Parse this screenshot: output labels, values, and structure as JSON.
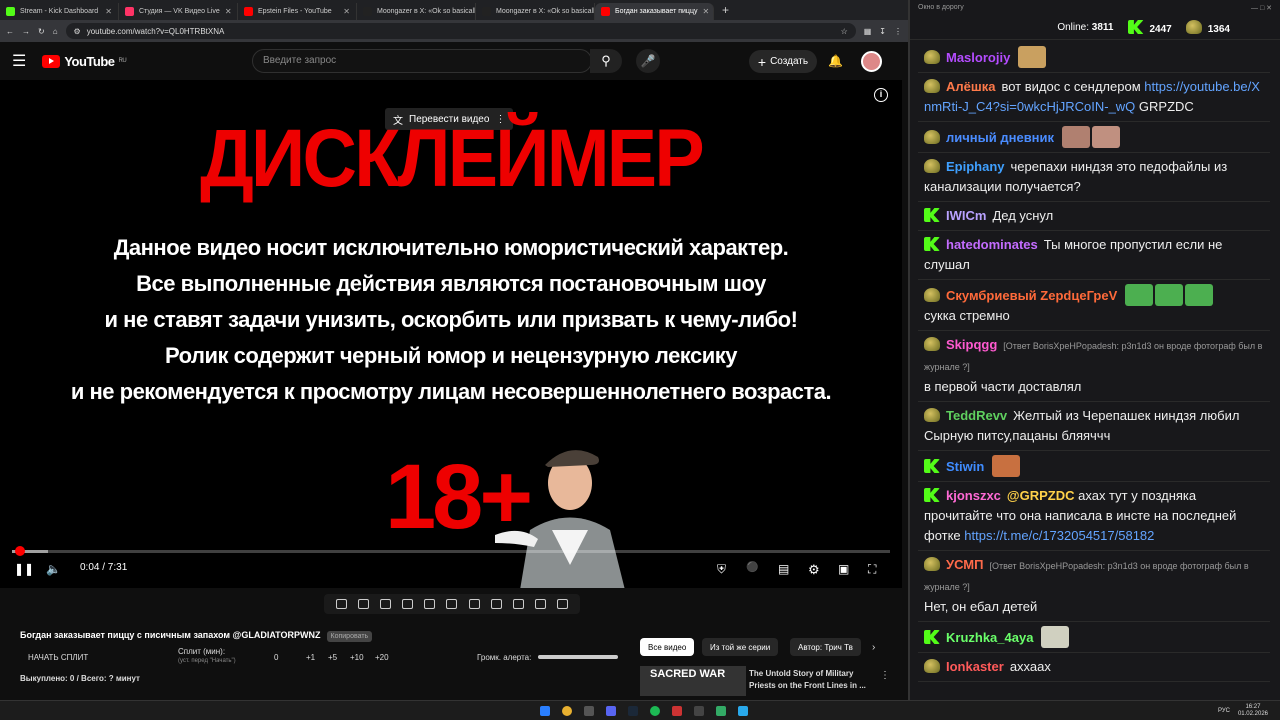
{
  "browser": {
    "tabs": [
      {
        "label": "Stream - Kick Dashboard",
        "color": "#53fc18"
      },
      {
        "label": "Студия — VK Видео Live",
        "color": "#ff3366"
      },
      {
        "label": "Epstein Files - YouTube",
        "color": "#ff0000"
      },
      {
        "label": "Moongazer в X: «Ok so basicall",
        "color": "#222222"
      },
      {
        "label": "Moongazer в X: «Ok so basicall",
        "color": "#222222"
      },
      {
        "label": "Богдан заказывает пиццу",
        "color": "#ff0000",
        "active": true
      }
    ],
    "url": "youtube.com/watch?v=QL0HTRBtXNA"
  },
  "yt": {
    "logo": "YouTube",
    "region": "RU",
    "search_placeholder": "Введите запрос",
    "create_label": "Создать"
  },
  "video": {
    "translate_label": "Перевести видео",
    "title": "ДИСКЛЕЙМЕР",
    "lines": [
      "Данное видео носит исключительно юмористический характер.",
      "Все выполненные действия являются постановочным шоу",
      "и не ставят задачи унизить, оскорбить или призвать к чему-либо!",
      "Ролик содержит черный юмор и нецензурную лексику",
      "и не рекомендуется к просмотру лицам несовершеннолетнего возраста."
    ],
    "age": "18+",
    "time": "0:04 / 7:31",
    "progress": 0.009
  },
  "below": {
    "title": "Богдан заказывает пиццу с писичным запахом @GLADIATORPWNZ",
    "copy_tag": "Копировать",
    "start_split": "НАЧАТЬ СПЛИТ",
    "split_label": "Сплит (мин):",
    "split_hint": "(уст. перед \"Начать\")",
    "split_values": [
      "0",
      "+1",
      "+5",
      "+10",
      "+20"
    ],
    "alert_label": "Громк. алерта:",
    "bought": "Выкуплено: 0 / Всего: ? минут",
    "chips": [
      "Все видео",
      "Из той же серии",
      "Автор: Трич Тв"
    ],
    "rec_thumb": "SACRED WAR",
    "rec_title": "The Untold Story of Military Priests on the Front Lines in ..."
  },
  "chat": {
    "window_title": "Окно в дорогу",
    "online_label": "Online:",
    "online": "3811",
    "kick_count": "2447",
    "other_count": "1364",
    "messages": [
      {
        "badge": "pepe",
        "name": "Maslorojiy",
        "color": "#b44cff",
        "text": "",
        "emotes": [
          "#c9a060"
        ]
      },
      {
        "badge": "pepe",
        "name": "Алёшка",
        "color": "#ff7a4a",
        "text": "вот видос с сендлером",
        "link": "https://youtube.be/XnmRti-J_C4?si=0wkcHjJRCoIN-_wQ",
        "after": "GRPZDC"
      },
      {
        "badge": "pepe",
        "name": "личный дневник",
        "color": "#4a8cff",
        "text": "",
        "emotes": [
          "#b08070",
          "#c09080"
        ]
      },
      {
        "badge": "pepe",
        "name": "Epiphany",
        "color": "#3fa0ff",
        "text": "черепахи ниндзя это педофайлы из канализации получается?"
      },
      {
        "badge": "kick",
        "name": "IWICm",
        "color": "#b9a2ff",
        "text": "Дед уснул"
      },
      {
        "badge": "kick",
        "name": "hatedominates",
        "color": "#c46cff",
        "text": "Ты многое пропустил если не слушал"
      },
      {
        "badge": "pepe",
        "name": "Скумбриевый ZерdцеГреV",
        "color": "#ff6a3a",
        "text": "",
        "emotes": [
          "#4caf50",
          "#4caf50",
          "#4caf50"
        ],
        "after": "сукка стремно"
      },
      {
        "badge": "pepe",
        "name": "Skipqgg",
        "color": "#ff5ad0",
        "reply": "[Ответ BorisXpeHPopadesh: p3n1d3 он вроде фотограф был в журнале ?]",
        "text": "в первой части доставлял"
      },
      {
        "badge": "pepe",
        "name": "TeddRevv",
        "color": "#5fd05f",
        "text": "Желтый из Черепашек ниндзя любил Сырную питсу,пацаны бляяччч"
      },
      {
        "badge": "kick",
        "name": "Stiwin",
        "color": "#3f8cff",
        "text": "",
        "emotes": [
          "#c87040"
        ]
      },
      {
        "badge": "kick",
        "name": "kjonszxc",
        "color": "#ff6ad5",
        "mention": "@GRPZDC",
        "text": "ахах тут у поздняка прочитайте что она написала в инсте на последней фотке",
        "link": "https://t.me/c/1732054517/58182"
      },
      {
        "badge": "pepe",
        "name": "УСМП",
        "color": "#ff6a4a",
        "reply": "[Ответ BorisXpeHPopadesh: p3n1d3 он вроде фотограф был в журнале ?]",
        "text": "Нет, он ебал детей"
      },
      {
        "badge": "kick",
        "name": "Kruzhka_4aya",
        "color": "#6aff6a",
        "text": "",
        "emotes": [
          "#d0d0c0"
        ]
      },
      {
        "badge": "pepe",
        "name": "Ionkaster",
        "color": "#ff5a5a",
        "text": "аххаах"
      }
    ]
  },
  "taskbar": {
    "lang": "РУС",
    "time": "16:27",
    "date": "01.02.2026"
  }
}
